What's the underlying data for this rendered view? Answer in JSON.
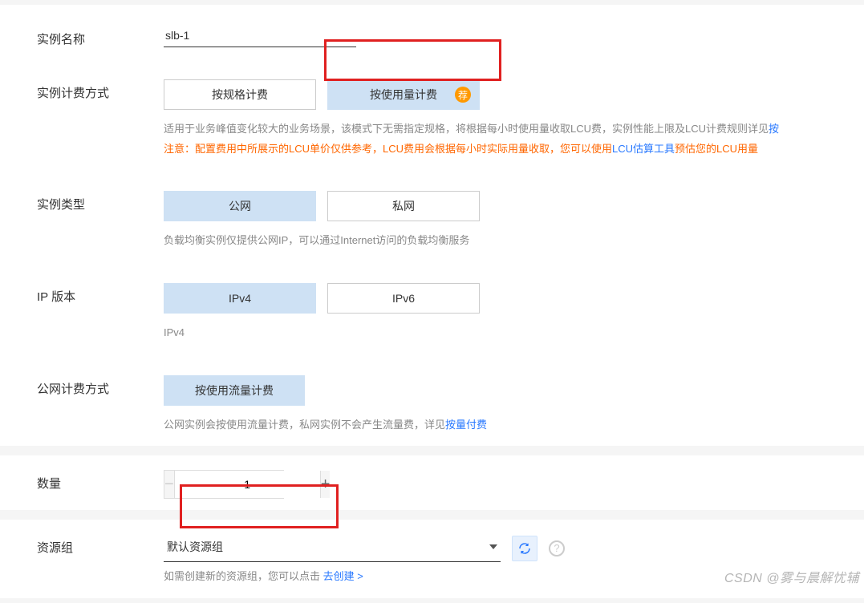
{
  "instance_name": {
    "label": "实例名称",
    "value": "slb-1"
  },
  "billing": {
    "label": "实例计费方式",
    "options": {
      "spec": "按规格计费",
      "usage": "按使用量计费"
    },
    "badge": "荐",
    "desc_prefix": "适用于业务峰值变化较大的业务场景，该模式下无需指定规格，将根据每小时使用量收取LCU费，实例性能上限及LCU计费规则详见",
    "desc_link": "按",
    "warn_prefix": "注意：配置费用中所展示的LCU单价仅供参考，LCU费用会根据每小时实际用量收取，您可以使用",
    "warn_link": "LCU估算工具",
    "warn_suffix": "预估您的LCU用量"
  },
  "instance_type": {
    "label": "实例类型",
    "options": {
      "public": "公网",
      "private": "私网"
    },
    "desc": "负载均衡实例仅提供公网IP，可以通过Internet访问的负载均衡服务"
  },
  "ip_version": {
    "label": "IP 版本",
    "options": {
      "v4": "IPv4",
      "v6": "IPv6"
    },
    "desc": "IPv4"
  },
  "public_billing": {
    "label": "公网计费方式",
    "option": "按使用流量计费",
    "desc_prefix": "公网实例会按使用流量计费，私网实例不会产生流量费，详见",
    "desc_link": "按量付费"
  },
  "quantity": {
    "label": "数量",
    "value": "1"
  },
  "resource_group": {
    "label": "资源组",
    "selected": "默认资源组",
    "desc_prefix": "如需创建新的资源组，您可以点击 ",
    "desc_link": "去创建 >"
  },
  "watermark": "CSDN @雾与晨解忧辅"
}
